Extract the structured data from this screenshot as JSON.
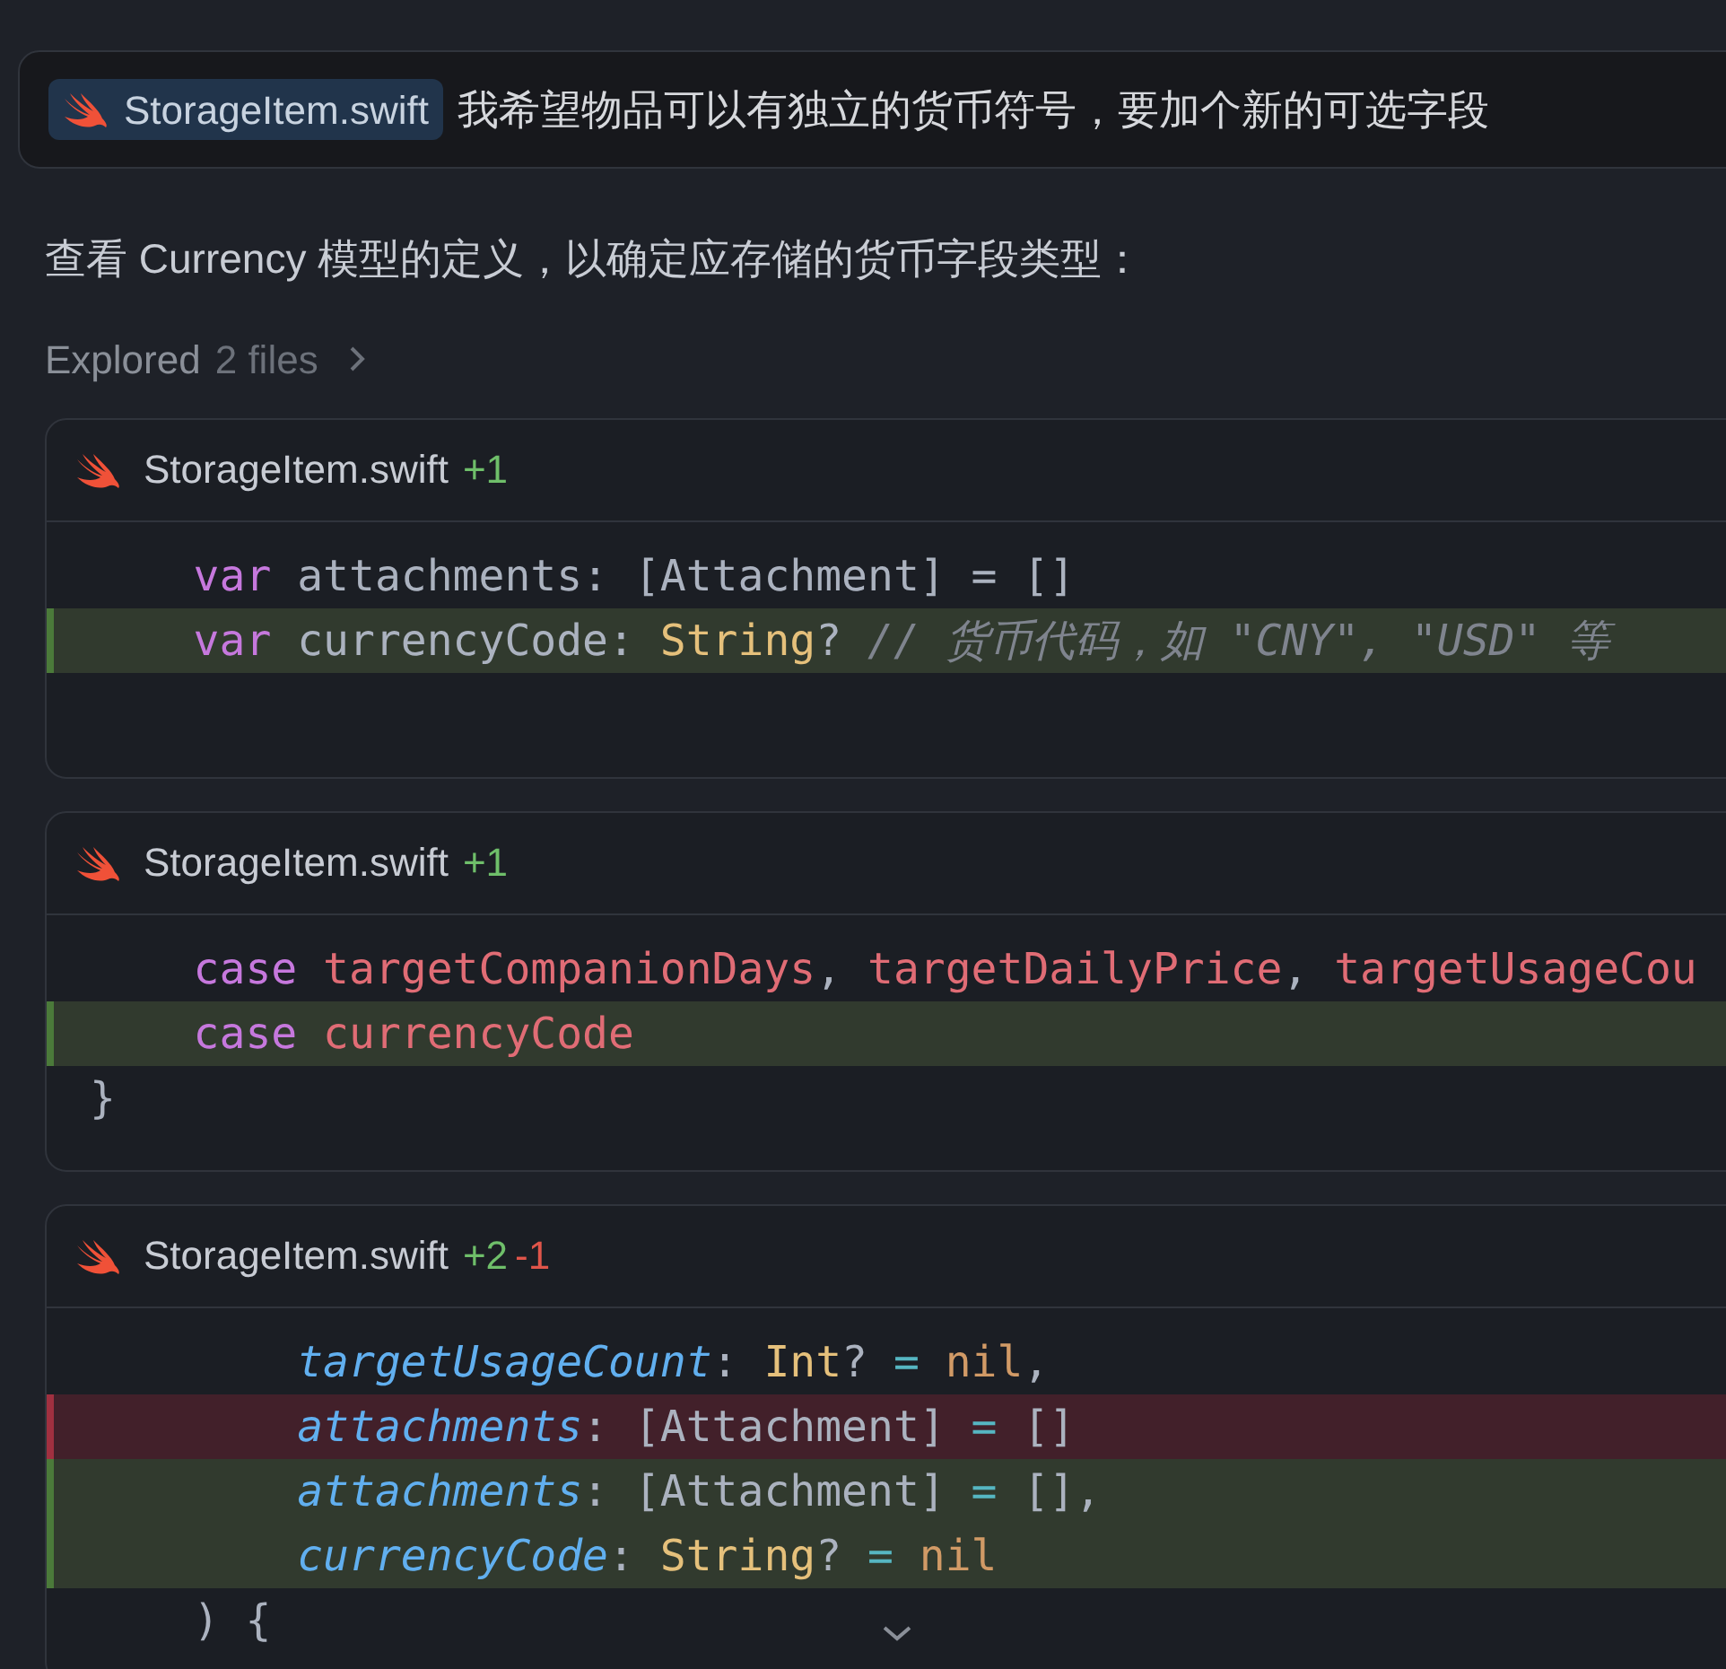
{
  "prompt": {
    "file_chip": "StorageItem.swift",
    "text": "我希望物品可以有独立的货币符号，要加个新的可选字段"
  },
  "message": "查看 Currency 模型的定义，以确定应存储的货币字段类型：",
  "explored": {
    "label": "Explored",
    "count": "2 files",
    "expanded": false
  },
  "diffs": [
    {
      "file": "StorageItem.swift",
      "added": "+1",
      "collapsed": false,
      "lines": [
        {
          "kind": "context",
          "tokens": [
            {
              "kind": "keyword",
              "text": "    var"
            },
            {
              "kind": "plain",
              "text": " attachments: [Attachment] = []"
            }
          ]
        },
        {
          "kind": "added",
          "tokens": [
            {
              "kind": "keyword",
              "text": "    var"
            },
            {
              "kind": "plain",
              "text": " currencyCode: "
            },
            {
              "kind": "type",
              "text": "String"
            },
            {
              "kind": "plain",
              "text": "? "
            },
            {
              "kind": "comment",
              "text": "// 货币代码，如 \"CNY\", \"USD\" 等"
            }
          ]
        }
      ]
    },
    {
      "file": "StorageItem.swift",
      "added": "+1",
      "collapsed": false,
      "lines": [
        {
          "kind": "context",
          "tokens": [
            {
              "kind": "keyword",
              "text": "    case "
            },
            {
              "kind": "ident",
              "text": "targetCompanionDays"
            },
            {
              "kind": "plain",
              "text": ", "
            },
            {
              "kind": "ident",
              "text": "targetDailyPrice"
            },
            {
              "kind": "plain",
              "text": ", "
            },
            {
              "kind": "ident",
              "text": "targetUsageCou"
            }
          ]
        },
        {
          "kind": "added",
          "tokens": [
            {
              "kind": "keyword",
              "text": "    case "
            },
            {
              "kind": "ident",
              "text": "currencyCode"
            }
          ]
        },
        {
          "kind": "context",
          "tokens": [
            {
              "kind": "plain",
              "text": "}"
            }
          ]
        }
      ]
    },
    {
      "file": "StorageItem.swift",
      "added": "+2",
      "removed": "-1",
      "collapsed": true,
      "lines": [
        {
          "kind": "context",
          "tokens": [
            {
              "kind": "param",
              "text": "        targetUsageCount"
            },
            {
              "kind": "plain",
              "text": ": "
            },
            {
              "kind": "type",
              "text": "Int"
            },
            {
              "kind": "plain",
              "text": "? "
            },
            {
              "kind": "operator",
              "text": "= "
            },
            {
              "kind": "literal",
              "text": "nil"
            },
            {
              "kind": "plain",
              "text": ","
            }
          ]
        },
        {
          "kind": "removed",
          "tokens": [
            {
              "kind": "param",
              "text": "        attachments"
            },
            {
              "kind": "plain",
              "text": ": [Attachment] "
            },
            {
              "kind": "operator",
              "text": "="
            },
            {
              "kind": "plain",
              "text": " []"
            }
          ]
        },
        {
          "kind": "added",
          "tokens": [
            {
              "kind": "param",
              "text": "        attachments"
            },
            {
              "kind": "plain",
              "text": ": [Attachment] "
            },
            {
              "kind": "operator",
              "text": "="
            },
            {
              "kind": "plain",
              "text": " [],"
            }
          ]
        },
        {
          "kind": "added",
          "tokens": [
            {
              "kind": "param",
              "text": "        currencyCode"
            },
            {
              "kind": "plain",
              "text": ": "
            },
            {
              "kind": "type",
              "text": "String"
            },
            {
              "kind": "plain",
              "text": "? "
            },
            {
              "kind": "operator",
              "text": "= "
            },
            {
              "kind": "literal",
              "text": "nil"
            }
          ]
        },
        {
          "kind": "context",
          "tokens": [
            {
              "kind": "plain",
              "text": "    ) {"
            }
          ]
        }
      ]
    }
  ]
}
